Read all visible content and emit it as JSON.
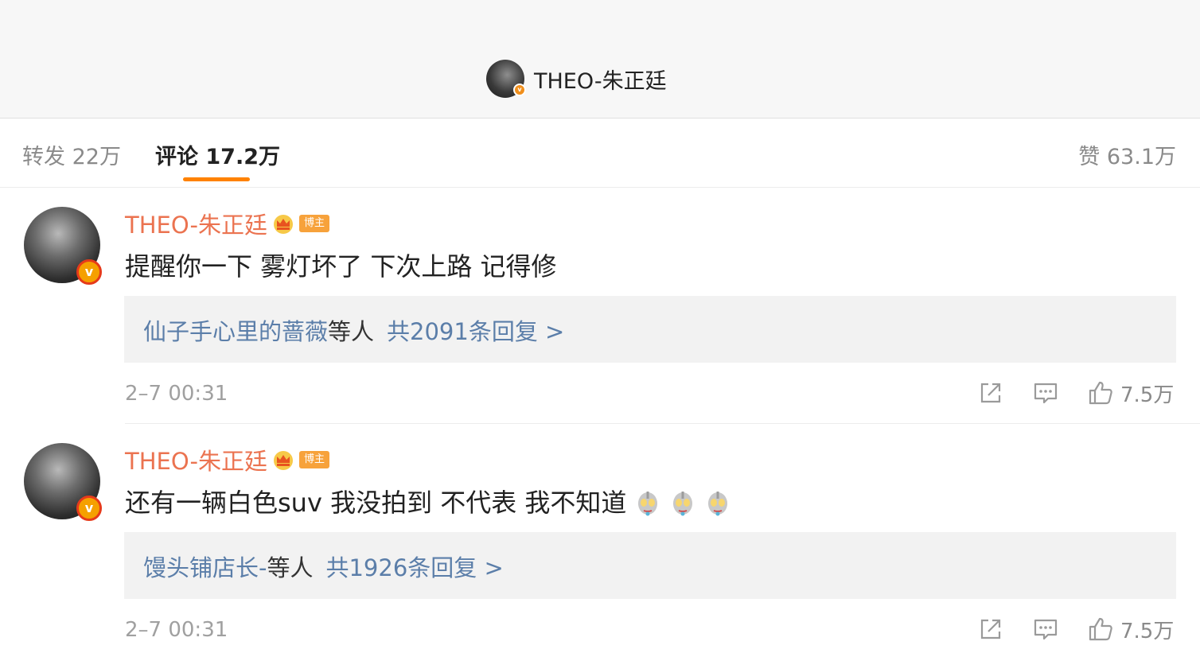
{
  "header": {
    "user_name": "THEO-朱正廷"
  },
  "tabs": {
    "repost": "转发 22万",
    "comment": "评论 17.2万",
    "like": "赞 63.1万"
  },
  "comments": [
    {
      "user": "THEO-朱正廷",
      "badge": "博主",
      "text": "提醒你一下 雾灯坏了 下次上路 记得修",
      "reply_users": "仙子手心里的蔷薇",
      "reply_deng": "等人",
      "reply_count": "共2091条回复 >",
      "time": "2–7 00:31",
      "likes": "7.5万"
    },
    {
      "user": "THEO-朱正廷",
      "badge": "博主",
      "text": "还有一辆白色suv 我没拍到 不代表 我不知道",
      "emoji": "ultraman-emoji",
      "reply_users": "馒头铺店长-",
      "reply_deng": "等人",
      "reply_count": "共1926条回复 >",
      "time": "2–7 00:31",
      "likes": "7.5万"
    }
  ],
  "colors": {
    "accent": "#ff8200",
    "username": "#eb7350",
    "link": "#5b7ea9"
  }
}
